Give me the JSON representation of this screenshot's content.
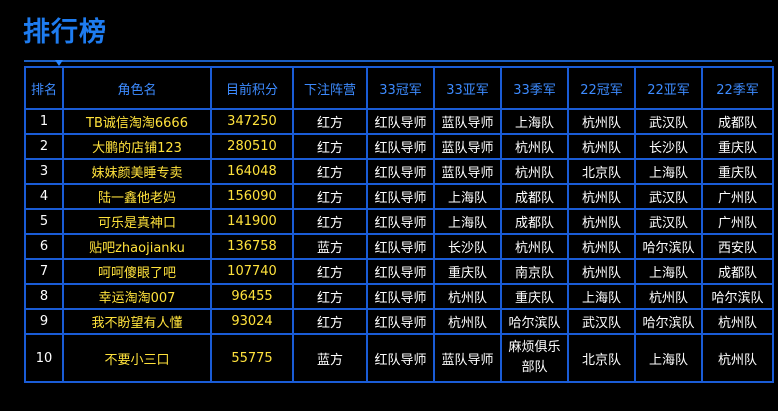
{
  "page": {
    "title": "排行榜"
  },
  "table": {
    "headers": [
      "排名",
      "角色名",
      "目前积分",
      "下注阵营",
      "33冠军",
      "33亚军",
      "33季军",
      "22冠军",
      "22亚军",
      "22季军"
    ],
    "rows": [
      {
        "rank": "1",
        "name": "TB诚信淘淘6666",
        "points": "347250",
        "camp": "红方",
        "c33_1": "红队导师",
        "c33_2": "蓝队导师",
        "c33_3": "上海队",
        "c22_1": "杭州队",
        "c22_2": "武汉队",
        "c22_3": "成都队"
      },
      {
        "rank": "2",
        "name": "大鹏的店铺123",
        "points": "280510",
        "camp": "红方",
        "c33_1": "红队导师",
        "c33_2": "蓝队导师",
        "c33_3": "杭州队",
        "c22_1": "杭州队",
        "c22_2": "长沙队",
        "c22_3": "重庆队"
      },
      {
        "rank": "3",
        "name": "妹妹颜美睡专卖",
        "points": "164048",
        "camp": "红方",
        "c33_1": "红队导师",
        "c33_2": "蓝队导师",
        "c33_3": "杭州队",
        "c22_1": "北京队",
        "c22_2": "上海队",
        "c22_3": "重庆队"
      },
      {
        "rank": "4",
        "name": "陆一鑫他老妈",
        "points": "156090",
        "camp": "红方",
        "c33_1": "红队导师",
        "c33_2": "上海队",
        "c33_3": "成都队",
        "c22_1": "杭州队",
        "c22_2": "武汉队",
        "c22_3": "广州队"
      },
      {
        "rank": "5",
        "name": "可乐是真神口",
        "points": "141900",
        "camp": "红方",
        "c33_1": "红队导师",
        "c33_2": "上海队",
        "c33_3": "成都队",
        "c22_1": "杭州队",
        "c22_2": "武汉队",
        "c22_3": "广州队"
      },
      {
        "rank": "6",
        "name": "贴吧zhaojianku",
        "points": "136758",
        "camp": "蓝方",
        "c33_1": "红队导师",
        "c33_2": "长沙队",
        "c33_3": "杭州队",
        "c22_1": "杭州队",
        "c22_2": "哈尔滨队",
        "c22_3": "西安队"
      },
      {
        "rank": "7",
        "name": "呵呵傻眼了吧",
        "points": "107740",
        "camp": "红方",
        "c33_1": "红队导师",
        "c33_2": "重庆队",
        "c33_3": "南京队",
        "c22_1": "杭州队",
        "c22_2": "上海队",
        "c22_3": "成都队"
      },
      {
        "rank": "8",
        "name": "幸运淘淘007",
        "points": "96455",
        "camp": "红方",
        "c33_1": "红队导师",
        "c33_2": "杭州队",
        "c33_3": "重庆队",
        "c22_1": "上海队",
        "c22_2": "杭州队",
        "c22_3": "哈尔滨队"
      },
      {
        "rank": "9",
        "name": "我不盼望有人懂",
        "points": "93024",
        "camp": "红方",
        "c33_1": "红队导师",
        "c33_2": "杭州队",
        "c33_3": "哈尔滨队",
        "c22_1": "武汉队",
        "c22_2": "哈尔滨队",
        "c22_3": "杭州队"
      },
      {
        "rank": "10",
        "name": "不要小三口",
        "points": "55775",
        "camp": "蓝方",
        "c33_1": "红队导师",
        "c33_2": "蓝队导师",
        "c33_3": "麻烦俱乐部队",
        "c22_1": "北京队",
        "c22_2": "上海队",
        "c22_3": "杭州队"
      }
    ]
  },
  "colors": {
    "background": "#000000",
    "title": "#1e7cf0",
    "border": "#1a5cd6",
    "header_text": "#3d8bff",
    "highlight_text": "#ffe23c",
    "cell_text": "#ffffff"
  }
}
